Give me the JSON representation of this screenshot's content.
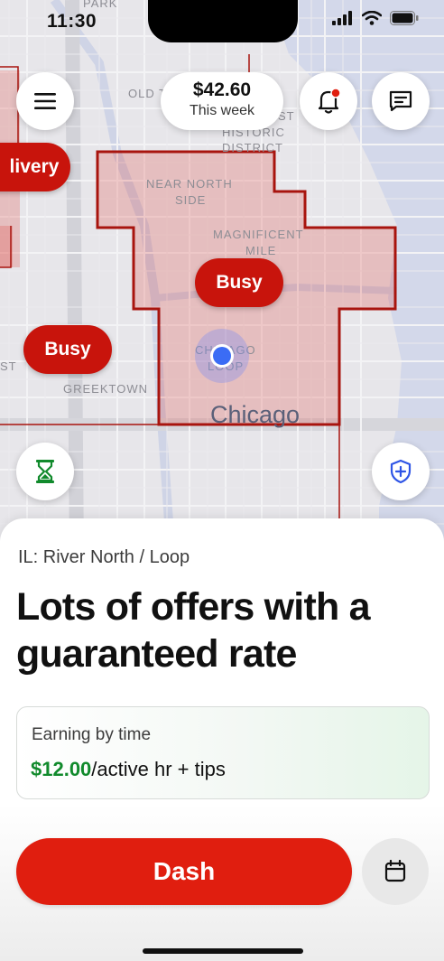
{
  "status_bar": {
    "time": "11:30"
  },
  "map": {
    "labels": {
      "park": "PARK",
      "old_town": "OLD T",
      "historic_1": "ST",
      "historic_2": "HISTORIC",
      "historic_3": "DISTRICT",
      "near_north_1": "NEAR NORTH",
      "near_north_2": "SIDE",
      "magnificent_1": "MAGNIFICENT",
      "magnificent_2": "MILE",
      "loop_1": "CHICAGO",
      "loop_2": "LOOP",
      "greektown": "GREEKTOWN",
      "chicago": "Chicago",
      "edge_st": "ST"
    },
    "delivery_pill": "livery",
    "busy_pills": [
      "Busy",
      "Busy"
    ],
    "zone_color": "#c8140c",
    "location_color": "#3b6cf5"
  },
  "earnings": {
    "amount": "$42.60",
    "period": "This week"
  },
  "icons": {
    "menu": "menu-icon",
    "notifications": "bell-icon",
    "messages": "chat-icon",
    "timer": "hourglass-icon",
    "safety": "shield-plus-icon",
    "schedule": "calendar-icon"
  },
  "sheet": {
    "region": "IL: River North / Loop",
    "headline": "Lots of offers with a guaranteed rate",
    "earn_card": {
      "label": "Earning by time",
      "amount": "$12.00",
      "suffix": "/active hr + tips"
    },
    "dash_label": "Dash"
  },
  "colors": {
    "accent": "#e01e0f",
    "green": "#118a2c"
  }
}
